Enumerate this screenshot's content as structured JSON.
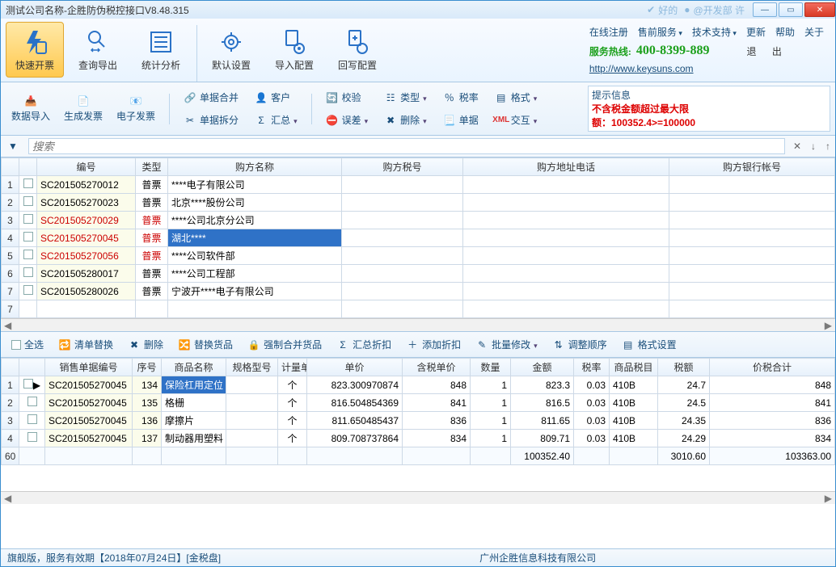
{
  "title": "测试公司名称-企胜防伪税控接口V8.48.315",
  "title_faded1": "好的",
  "title_faded2": "@开发部 许",
  "ribbon": {
    "btns": [
      {
        "label": "快速开票"
      },
      {
        "label": "查询导出"
      },
      {
        "label": "统计分析"
      },
      {
        "label": "默认设置"
      },
      {
        "label": "导入配置"
      },
      {
        "label": "回写配置"
      }
    ],
    "links": [
      "在线注册",
      "售前服务",
      "技术支持",
      "更新",
      "帮助",
      "关于"
    ],
    "hotline_label": "服务热线:",
    "hotline_number": "400-8399-889",
    "exit": "退 出",
    "url": "http://www.keysuns.com"
  },
  "toolbar2": {
    "g1": [
      "数据导入",
      "生成发票",
      "电子发票"
    ],
    "g2": [
      "单据合并",
      "单据拆分"
    ],
    "g3": [
      "客户",
      "汇总"
    ],
    "g4": [
      "校验",
      "误差"
    ],
    "g5": [
      "类型",
      "删除"
    ],
    "g6": [
      "税率",
      "单据"
    ],
    "g7": [
      "格式",
      "交互"
    ],
    "xml": "XML"
  },
  "alert": {
    "header": "提示信息",
    "line1": "不含税金额超过最大限",
    "line2": "额：100352.4>=100000"
  },
  "search_placeholder": "搜索",
  "grid1": {
    "headers": [
      "",
      "",
      "编号",
      "类型",
      "购方名称",
      "购方税号",
      "购方地址电话",
      "购方银行帐号"
    ],
    "rows": [
      {
        "n": "1",
        "id": "SC201505270012",
        "type": "普票",
        "name": "****电子有限公司",
        "red": false,
        "sel": false
      },
      {
        "n": "2",
        "id": "SC201505270023",
        "type": "普票",
        "name": "北京****股份公司",
        "red": false,
        "sel": false
      },
      {
        "n": "3",
        "id": "SC201505270029",
        "type": "普票",
        "name": "****公司北京分公司",
        "red": true,
        "sel": false
      },
      {
        "n": "4",
        "id": "SC201505270045",
        "type": "普票",
        "name": "湖北****",
        "red": true,
        "sel": true
      },
      {
        "n": "5",
        "id": "SC201505270056",
        "type": "普票",
        "name": "****公司软件部",
        "red": true,
        "sel": false
      },
      {
        "n": "6",
        "id": "SC201505280017",
        "type": "普票",
        "name": "****公司工程部",
        "red": false,
        "sel": false
      },
      {
        "n": "7",
        "id": "SC201505280026",
        "type": "普票",
        "name": "宁波开****电子有限公司",
        "red": false,
        "sel": false
      }
    ],
    "extra_row": "7"
  },
  "detail_btns": [
    "全选",
    "清单替换",
    "删除",
    "替换货品",
    "强制合并货品",
    "汇总折扣",
    "添加折扣",
    "批量修改",
    "调整顺序",
    "格式设置"
  ],
  "grid2": {
    "headers": [
      "",
      "",
      "销售单据编号",
      "序号",
      "商品名称",
      "规格型号",
      "计量单位",
      "单价",
      "含税单价",
      "数量",
      "金额",
      "税率",
      "商品税目",
      "税额",
      "价税合计"
    ],
    "rows": [
      {
        "n": "1",
        "doc": "SC201505270045",
        "seq": "134",
        "name": "保险杠用定位",
        "unit": "个",
        "price": "823.300970874",
        "pricet": "848",
        "qty": "1",
        "amt": "823.3",
        "rate": "0.03",
        "cat": "410B",
        "tax": "24.7",
        "total": "848",
        "sel": true
      },
      {
        "n": "2",
        "doc": "SC201505270045",
        "seq": "135",
        "name": "格栅",
        "unit": "个",
        "price": "816.504854369",
        "pricet": "841",
        "qty": "1",
        "amt": "816.5",
        "rate": "0.03",
        "cat": "410B",
        "tax": "24.5",
        "total": "841",
        "sel": false
      },
      {
        "n": "3",
        "doc": "SC201505270045",
        "seq": "136",
        "name": "摩擦片",
        "unit": "个",
        "price": "811.650485437",
        "pricet": "836",
        "qty": "1",
        "amt": "811.65",
        "rate": "0.03",
        "cat": "410B",
        "tax": "24.35",
        "total": "836",
        "sel": false
      },
      {
        "n": "4",
        "doc": "SC201505270045",
        "seq": "137",
        "name": "制动器用塑料",
        "unit": "个",
        "price": "809.708737864",
        "pricet": "834",
        "qty": "1",
        "amt": "809.71",
        "rate": "0.03",
        "cat": "410B",
        "tax": "24.29",
        "total": "834",
        "sel": false
      }
    ],
    "sum": {
      "n": "60",
      "amt": "100352.40",
      "tax": "3010.60",
      "total": "103363.00"
    }
  },
  "status": {
    "left": "旗舰版，服务有效期【2018年07月24日】[金税盘]",
    "mid": "广州企胜信息科技有限公司"
  }
}
